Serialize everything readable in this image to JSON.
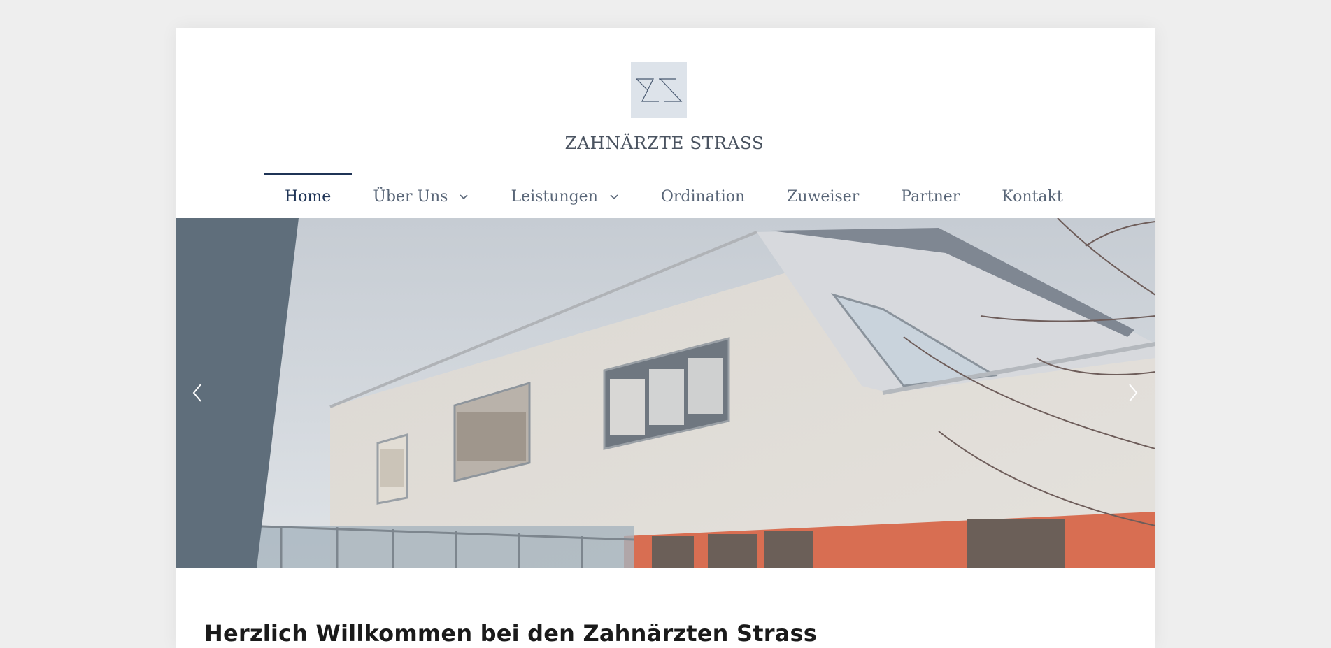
{
  "brand": {
    "logo_icon": "zs-monogram-icon",
    "title": "ZAHNÄRZTE STRASS",
    "logo_bg": "#dde3ea"
  },
  "nav": {
    "items": [
      {
        "label": "Home",
        "active": true,
        "has_dropdown": false
      },
      {
        "label": "Über Uns",
        "active": false,
        "has_dropdown": true
      },
      {
        "label": "Leistungen",
        "active": false,
        "has_dropdown": true
      },
      {
        "label": "Ordination",
        "active": false,
        "has_dropdown": false
      },
      {
        "label": "Zuweiser",
        "active": false,
        "has_dropdown": false
      },
      {
        "label": "Partner",
        "active": false,
        "has_dropdown": false
      },
      {
        "label": "Kontakt",
        "active": false,
        "has_dropdown": false
      }
    ],
    "active_color": "#1f3456",
    "text_color": "#586577"
  },
  "hero": {
    "image": "modern-building-photo",
    "prev_icon": "chevron-left-icon",
    "next_icon": "chevron-right-icon"
  },
  "content": {
    "heading": "Herzlich Willkommen bei den Zahnärzten Strass"
  }
}
